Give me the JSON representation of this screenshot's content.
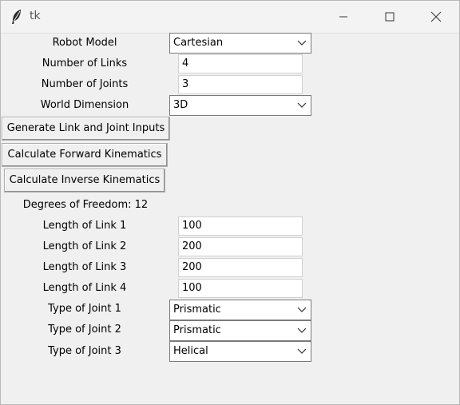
{
  "window": {
    "title": "tk"
  },
  "form": {
    "robot_model": {
      "label": "Robot Model",
      "value": "Cartesian"
    },
    "num_links": {
      "label": "Number of Links",
      "value": "4"
    },
    "num_joints": {
      "label": "Number of Joints",
      "value": "3"
    },
    "world_dimension": {
      "label": "World Dimension",
      "value": "3D"
    }
  },
  "buttons": {
    "generate": "Generate Link and Joint Inputs",
    "forward": "Calculate Forward Kinematics",
    "inverse": "Calculate Inverse Kinematics"
  },
  "dof_text": "Degrees of Freedom: 12",
  "links": [
    {
      "label": "Length of Link 1",
      "value": "100"
    },
    {
      "label": "Length of Link 2",
      "value": "200"
    },
    {
      "label": "Length of Link 3",
      "value": "200"
    },
    {
      "label": "Length of Link 4",
      "value": "100"
    }
  ],
  "joints": [
    {
      "label": "Type of Joint 1",
      "value": "Prismatic"
    },
    {
      "label": "Type of Joint 2",
      "value": "Prismatic"
    },
    {
      "label": "Type of Joint 3",
      "value": "Helical"
    }
  ]
}
